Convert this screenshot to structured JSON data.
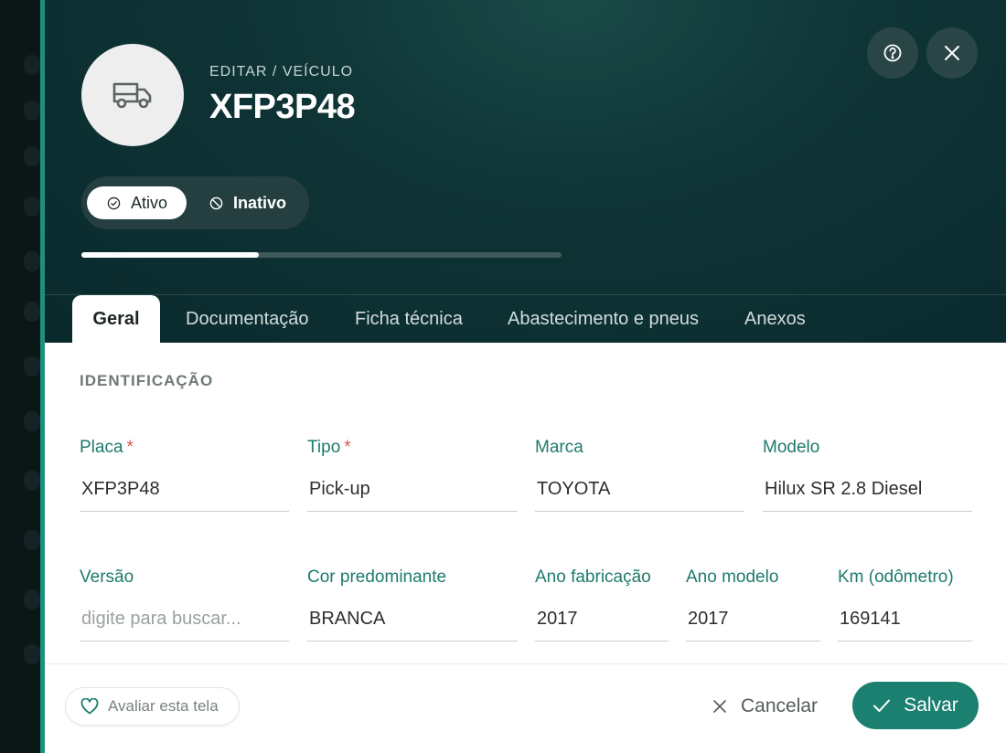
{
  "header": {
    "breadcrumb": "EDITAR / VEÍCULO",
    "title": "XFP3P48",
    "avatar_icon": "truck-icon",
    "progress_fraction": 0.37
  },
  "status": {
    "active_label": "Ativo",
    "inactive_label": "Inativo",
    "selected": "Ativo"
  },
  "tabs": [
    {
      "label": "Geral",
      "active": true
    },
    {
      "label": "Documentação",
      "active": false
    },
    {
      "label": "Ficha técnica",
      "active": false
    },
    {
      "label": "Abastecimento e pneus",
      "active": false
    },
    {
      "label": "Anexos",
      "active": false
    }
  ],
  "section": {
    "title": "IDENTIFICAÇÃO"
  },
  "fields": {
    "placa": {
      "label": "Placa",
      "required": "*",
      "value": "XFP3P48"
    },
    "tipo": {
      "label": "Tipo",
      "required": "*",
      "value": "Pick-up"
    },
    "marca": {
      "label": "Marca",
      "value": "TOYOTA"
    },
    "modelo": {
      "label": "Modelo",
      "value": "Hilux SR 2.8 Diesel"
    },
    "versao": {
      "label": "Versão",
      "placeholder": "digite para buscar..."
    },
    "cor": {
      "label": "Cor predominante",
      "value": "BRANCA"
    },
    "ano_fabricacao": {
      "label": "Ano fabricação",
      "value": "2017"
    },
    "ano_modelo": {
      "label": "Ano modelo",
      "value": "2017"
    },
    "km": {
      "label": "Km (odômetro)",
      "value": "169141"
    }
  },
  "footer": {
    "rate_label": "Avaliar esta tela",
    "cancel_label": "Cancelar",
    "save_label": "Salvar"
  },
  "colors": {
    "accent": "#1b8070",
    "header_bg": "#0f3436",
    "label": "#1e7a6c",
    "required": "#d9534f"
  }
}
